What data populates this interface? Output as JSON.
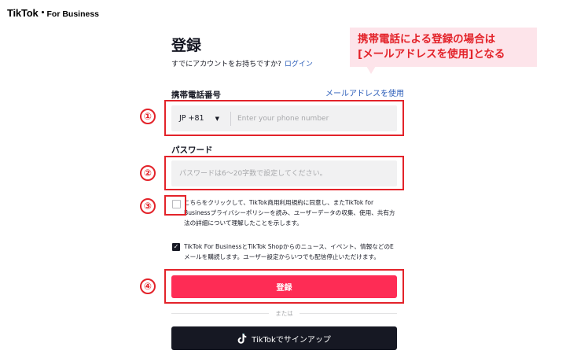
{
  "brand": {
    "name": "TikTok",
    "suffix": "For Business"
  },
  "form": {
    "title": "登録",
    "login_prompt": "すでにアカウントをお持ちですか?",
    "login_link": "ログイン",
    "phone_label": "携帯電話番号",
    "email_switch": "メールアドレスを使用",
    "country_code": "JP +81",
    "phone_placeholder": "Enter your phone number",
    "password_label": "パスワード",
    "password_placeholder": "パスワードは6～20字数で設定してください。",
    "terms_text": "こちらをクリックして、TikTok商用利用規約に同意し、またTikTok for Businessプライバシーポリシーを読み、ユーザーデータの収集、使用、共有方法の詳細について理解したことを示します。",
    "terms_checked": false,
    "marketing_text": "TikTok For BusinessとTikTok Shopからのニュース、イベント、情報などのEメールを購読します。ユーザー設定からいつでも配信停止いただけます。",
    "marketing_checked": true,
    "register_button": "登録",
    "or_text": "または",
    "tiktok_signup": "TikTokでサインアップ"
  },
  "annotations": {
    "markers": [
      "①",
      "②",
      "③",
      "④"
    ],
    "callout_lines": [
      "携帯電話による登録の場合は",
      "[メールアドレスを使用]となる"
    ],
    "accent_color": "#e3232a",
    "callout_bg": "#fde4ea"
  },
  "colors": {
    "primary": "#fe2c55",
    "link": "#2b5db9",
    "dark": "#161823",
    "field_bg": "#f1f1f2"
  }
}
